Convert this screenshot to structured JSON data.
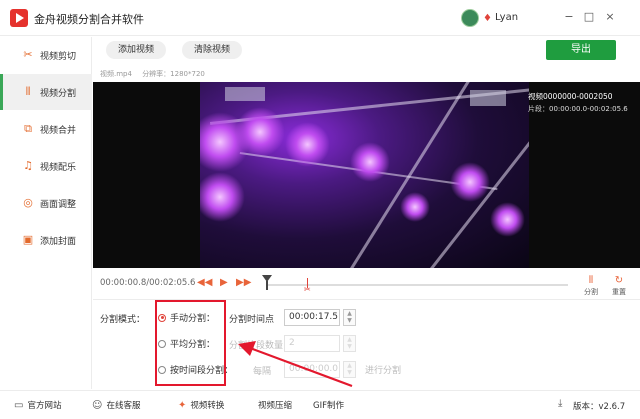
{
  "app": {
    "title": "金舟视频分割合并软件",
    "username": "Lyan",
    "window_controls": [
      "−",
      "□",
      "×"
    ]
  },
  "sidebar": {
    "items": [
      {
        "label": "视频剪切",
        "icon": "scissors-icon",
        "active": false
      },
      {
        "label": "视频分割",
        "icon": "split-icon",
        "active": true
      },
      {
        "label": "视频合并",
        "icon": "merge-icon",
        "active": false
      },
      {
        "label": "视频配乐",
        "icon": "music-icon",
        "active": false
      },
      {
        "label": "画面调整",
        "icon": "adjust-icon",
        "active": false
      },
      {
        "label": "添加封面",
        "icon": "cover-icon",
        "active": false
      }
    ]
  },
  "toolbar": {
    "add_video": "添加视频",
    "clear_video": "清除视频",
    "export": "导出"
  },
  "file": {
    "name": "视频.mp4",
    "resolution": "分辨率：1280*720"
  },
  "preview": {
    "clip_name": "视频0000000-0002050",
    "clip_range": "片段：00:00:00.0-00:02:05.6"
  },
  "timeline": {
    "timecode": "00:00:00.8/00:02:05.6",
    "split_label": "分割",
    "reset_label": "重置"
  },
  "split": {
    "mode_label": "分割模式：",
    "options": [
      "手动分割：",
      "平均分割：",
      "按时间段分割："
    ],
    "selected_index": 0,
    "manual_time_label": "分割时间点",
    "manual_time_value": "00:00:17.5",
    "avg_count_label": "分割片段数量",
    "avg_count_value": "2",
    "interval_label": "每隔",
    "interval_value": "00:00:00.0",
    "run_label": "进行分割"
  },
  "footer": {
    "items": [
      "官方网站",
      "在线客服",
      "视频转换",
      "视频压缩",
      "GIF制作"
    ],
    "version": "版本：v2.6.7"
  },
  "colors": {
    "accent_green": "#1f9d3f",
    "accent_orange": "#e8643a",
    "highlight_red": "#e3182d"
  }
}
